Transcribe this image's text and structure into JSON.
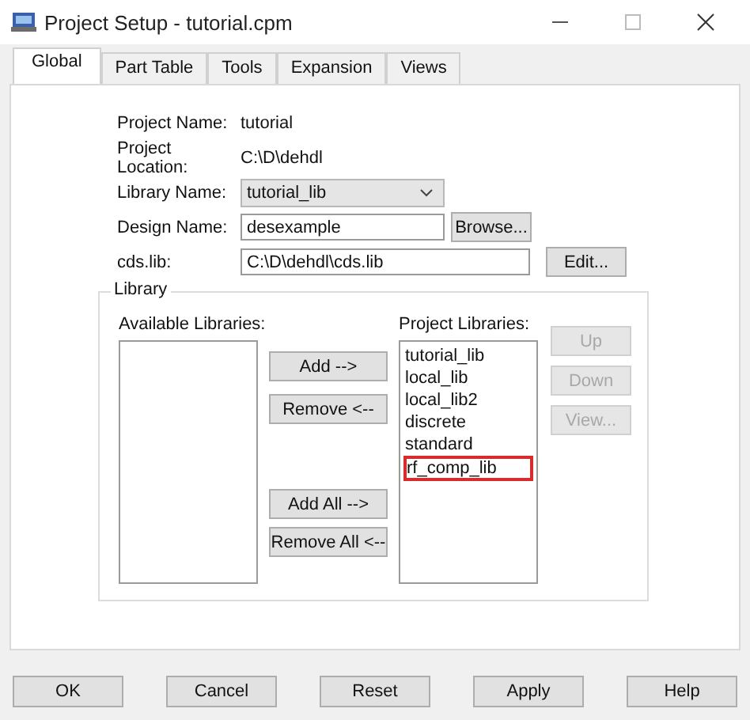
{
  "window": {
    "title": "Project Setup - tutorial.cpm"
  },
  "tabs": [
    {
      "label": "Global",
      "selected": true
    },
    {
      "label": "Part Table",
      "selected": false
    },
    {
      "label": "Tools",
      "selected": false
    },
    {
      "label": "Expansion",
      "selected": false
    },
    {
      "label": "Views",
      "selected": false
    }
  ],
  "project_name": {
    "label": "Project Name:",
    "value": "tutorial"
  },
  "project_location": {
    "label": "Project Location:",
    "value": "C:\\D\\dehdl"
  },
  "library_name": {
    "label": "Library Name:",
    "value": "tutorial_lib"
  },
  "design_name": {
    "label": "Design Name:",
    "value": "desexample",
    "button": "Browse..."
  },
  "cds_lib": {
    "label": "cds.lib:",
    "value": "C:\\D\\dehdl\\cds.lib",
    "button": "Edit..."
  },
  "library": {
    "title": "Library",
    "available_label": "Available Libraries:",
    "project_label": "Project Libraries:",
    "project_libraries": [
      {
        "name": "tutorial_lib",
        "highlighted": false
      },
      {
        "name": "local_lib",
        "highlighted": false
      },
      {
        "name": "local_lib2",
        "highlighted": false
      },
      {
        "name": "discrete",
        "highlighted": false
      },
      {
        "name": "standard",
        "highlighted": false
      },
      {
        "name": "rf_comp_lib",
        "highlighted": true
      }
    ],
    "move_buttons": [
      {
        "label": "Add -->",
        "disabled": false
      },
      {
        "label": "Remove <--",
        "disabled": false
      },
      {
        "label": "Add All -->",
        "disabled": false
      },
      {
        "label": "Remove All <--",
        "disabled": false
      }
    ],
    "order_buttons": [
      {
        "label": "Up",
        "disabled": true
      },
      {
        "label": "Down",
        "disabled": true
      },
      {
        "label": "View...",
        "disabled": true
      }
    ]
  },
  "buttons": [
    "OK",
    "Cancel",
    "Reset",
    "Apply",
    "Help"
  ]
}
